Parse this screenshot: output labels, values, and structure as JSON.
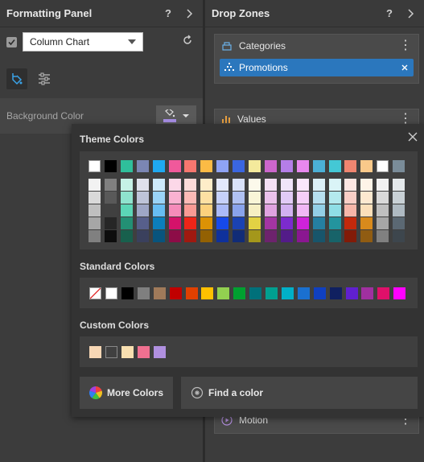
{
  "left_panel": {
    "title": "Formatting Panel",
    "help_label": "?",
    "chart_type": "Column Chart",
    "bg_label": "Background Color",
    "bg_color": "#a88fe6"
  },
  "right_panel": {
    "title": "Drop Zones",
    "help_label": "?",
    "zones": {
      "categories": "Categories",
      "values": "Values",
      "motion": "Motion"
    },
    "chip_label": "Promotions"
  },
  "popup": {
    "theme_title": "Theme Colors",
    "standard_title": "Standard Colors",
    "custom_title": "Custom Colors",
    "more_colors_label": "More Colors",
    "find_color_label": "Find a color",
    "theme_top_row": [
      "#ffffff",
      "#000000",
      "#2fbf9b",
      "#7b86b4",
      "#1fa9f0",
      "#f0599b",
      "#f7776f",
      "#fbbb45",
      "#8ea3f4",
      "#3a66e0",
      "#f4ea9c",
      "#cc66cc",
      "#b57ee8",
      "#e888ef",
      "#4bb0d6",
      "#44c8d5",
      "#f08570",
      "#f9c98a",
      "#ffffff",
      "#7a8c99"
    ],
    "theme_columns": [
      [
        "#f2f2f2",
        "#d9d9d9",
        "#bfbfbf",
        "#a6a6a6",
        "#808080"
      ],
      [
        "#808080",
        "#595959",
        "#404040",
        "#262626",
        "#0d0d0d"
      ],
      [
        "#c6f1e6",
        "#8fe3ce",
        "#5bd6b6",
        "#239074",
        "#18604d"
      ],
      [
        "#dfe1ec",
        "#bec4d9",
        "#9ea6c6",
        "#575f8b",
        "#3a405d"
      ],
      [
        "#cce9fb",
        "#9ad3f7",
        "#67bdf3",
        "#0c7ebc",
        "#08547d"
      ],
      [
        "#fcd8e8",
        "#f9b2d1",
        "#f58bba",
        "#d4126a",
        "#8d0c47"
      ],
      [
        "#fcdad8",
        "#fbbab6",
        "#f99a94",
        "#ee2518",
        "#9f1910"
      ],
      [
        "#feedc9",
        "#fde0a3",
        "#fcd17c",
        "#dc9205",
        "#936103"
      ],
      [
        "#e3e9fd",
        "#c6d1fa",
        "#aabaf8",
        "#1649ea",
        "#0f319c"
      ],
      [
        "#d8e1f9",
        "#b0c1f2",
        "#89a3ec",
        "#1a42b3",
        "#112c77"
      ],
      [
        "#fcf9eb",
        "#f9f5d7",
        "#f6efc3",
        "#e2d244",
        "#a4971b"
      ],
      [
        "#f5e0f5",
        "#ebc2eb",
        "#e0a3e0",
        "#a335a3",
        "#6d236d"
      ],
      [
        "#f0e5fa",
        "#e1cbf6",
        "#d2b1f1",
        "#7c2bce",
        "#531c89"
      ],
      [
        "#fae7fc",
        "#f6cff9",
        "#f1b7f5",
        "#cf23da",
        "#8a1791"
      ],
      [
        "#dbeff7",
        "#b7dfef",
        "#93cfe6",
        "#257fa1",
        "#18556b"
      ],
      [
        "#daf4f7",
        "#b4e9ee",
        "#8fdee6",
        "#23949e",
        "#176369"
      ],
      [
        "#fce6e2",
        "#f9cec6",
        "#f6b6a9",
        "#c3290c",
        "#821b08"
      ],
      [
        "#fef4e8",
        "#fde9d0",
        "#fbdfb9",
        "#d88a1c",
        "#905c12"
      ],
      [
        "#f2f2f2",
        "#d9d9d9",
        "#bfbfbf",
        "#a6a6a6",
        "#808080"
      ],
      [
        "#e4e8eb",
        "#c9d1d6",
        "#afbac2",
        "#5b6873",
        "#3d464d"
      ]
    ],
    "standard_colors": [
      "#ffffff",
      "#000000",
      "#7f7f7f",
      "#a07a5a",
      "#c00000",
      "#e04000",
      "#ffc000",
      "#92d050",
      "#00a030",
      "#00707a",
      "#00a090",
      "#00b0c8",
      "#1a70d0",
      "#1040c0",
      "#102060",
      "#6020d0",
      "#a030a0",
      "#e0106a",
      "#ff00ff"
    ],
    "custom_colors": [
      "#f7d7b5",
      "#404040",
      "#f8dfb0",
      "#f07090",
      "#b090e0"
    ]
  }
}
